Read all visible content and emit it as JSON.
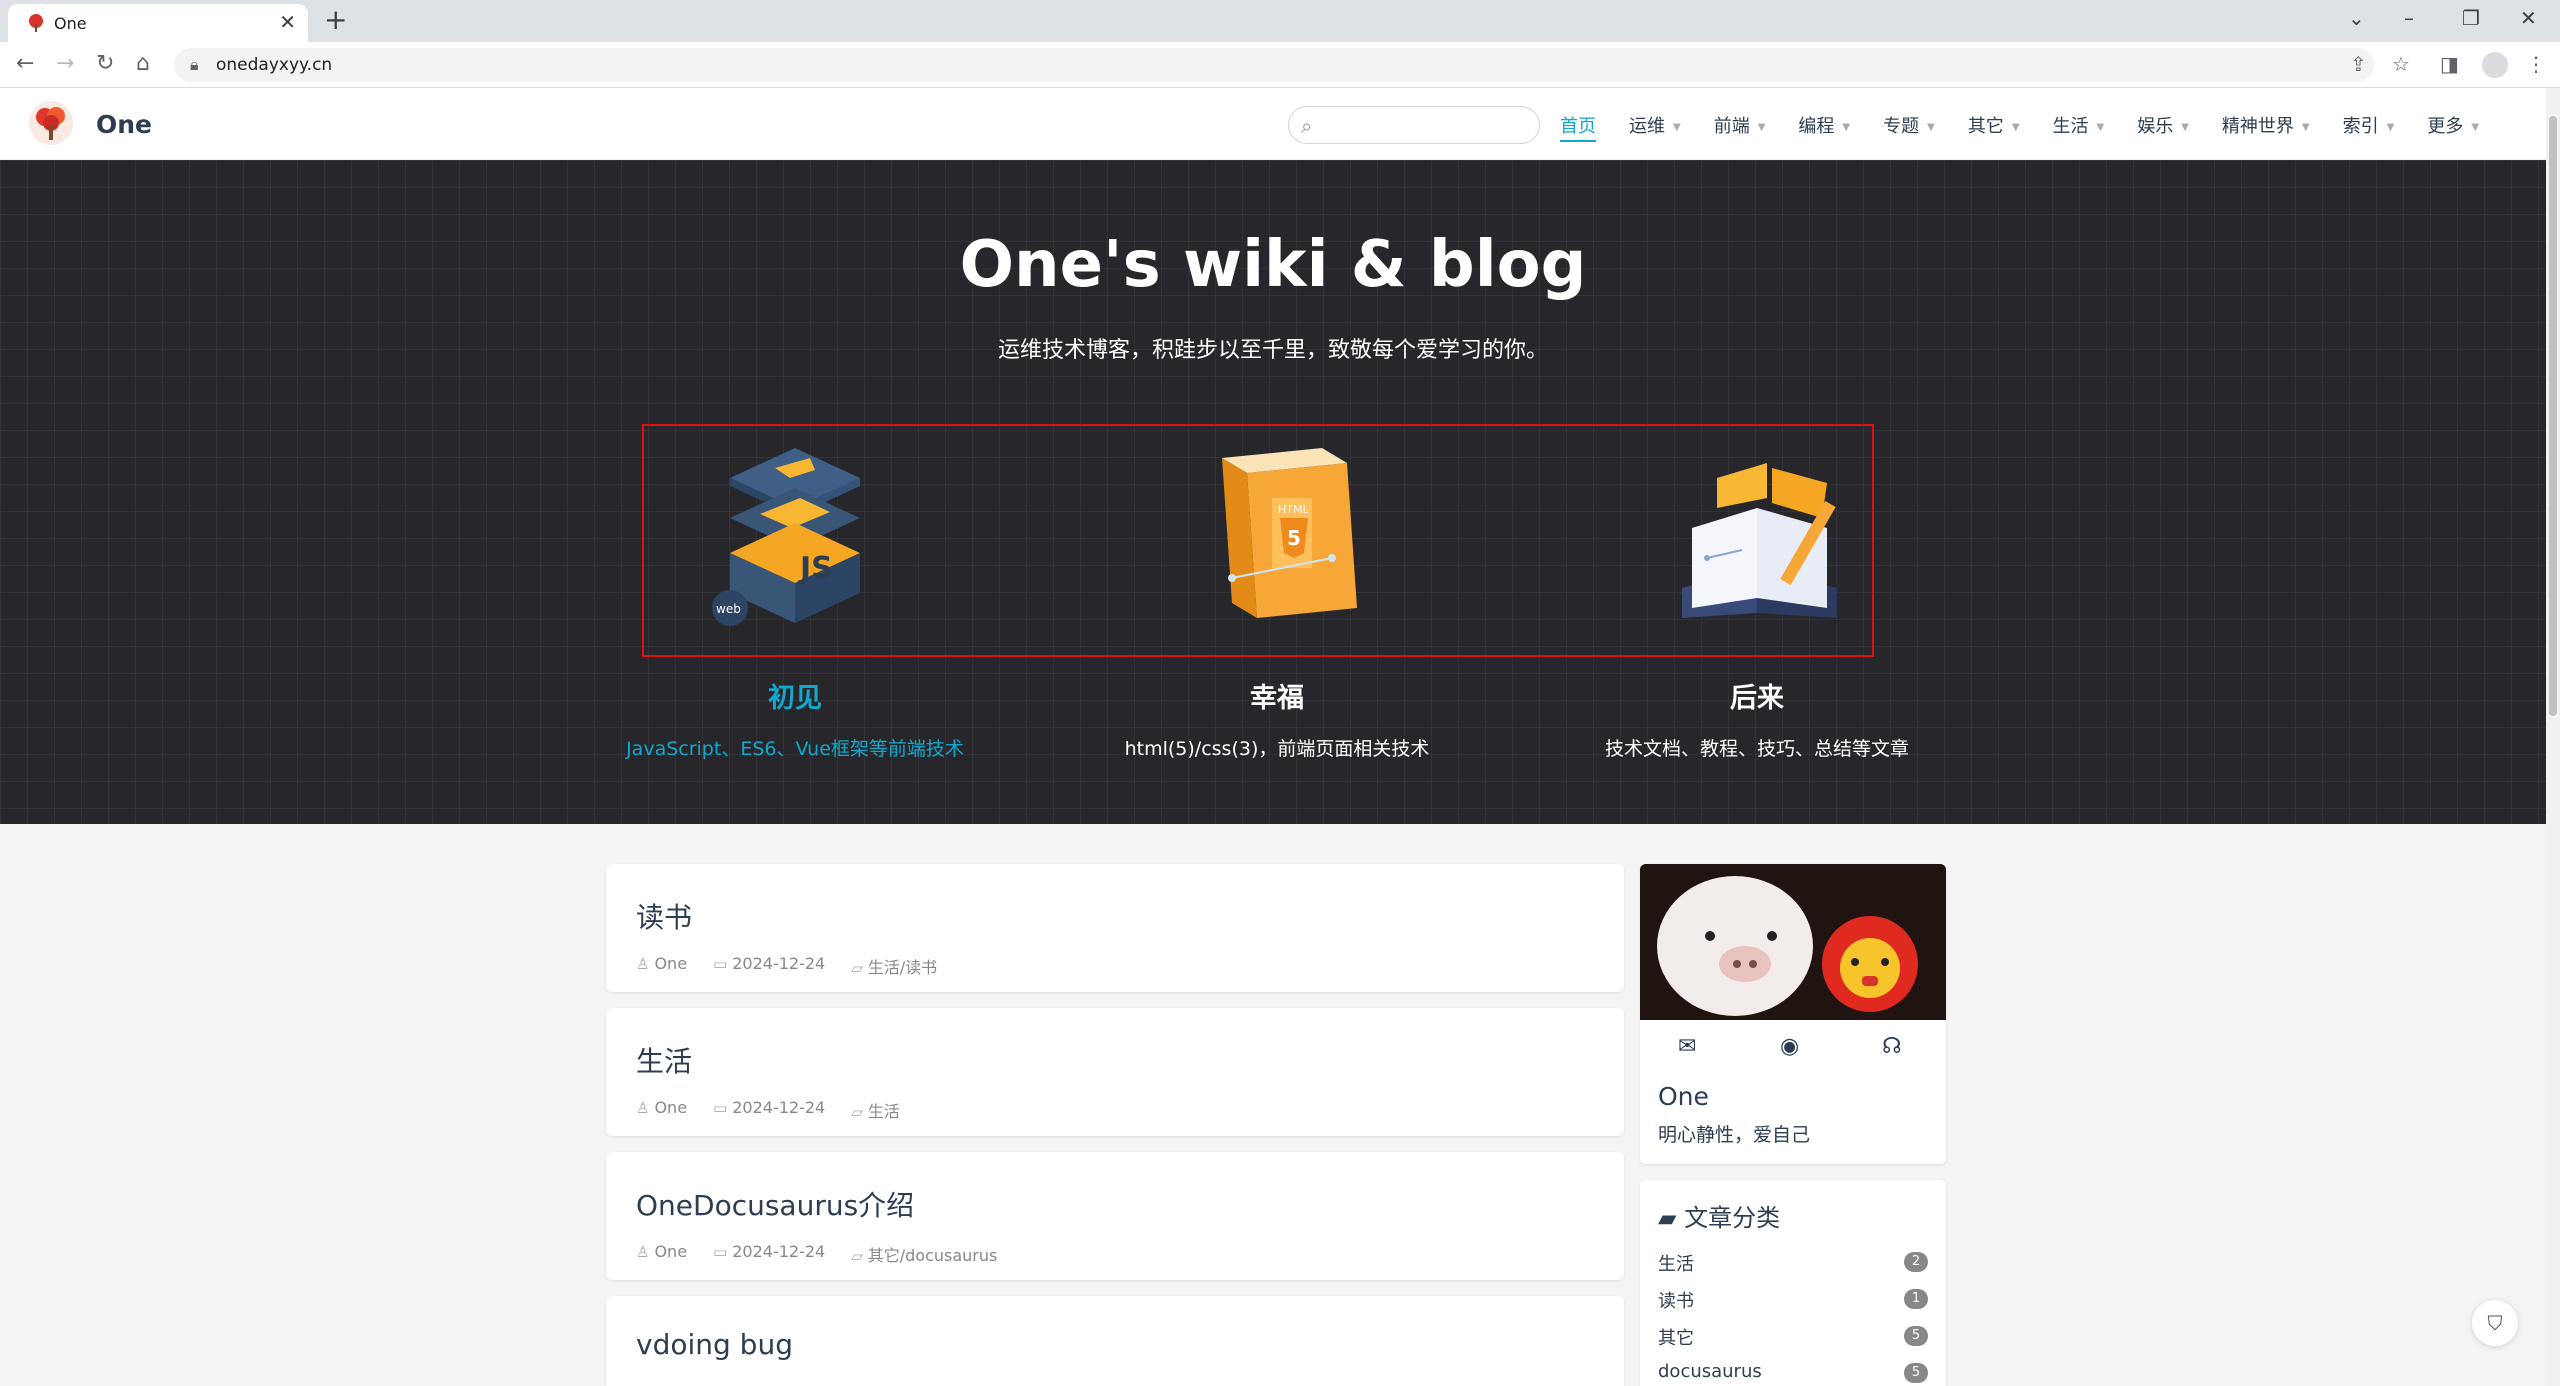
{
  "browser": {
    "tab_title": "One",
    "tab_close": "✕",
    "new_tab": "+",
    "url": "onedayxyy.cn"
  },
  "site": {
    "name": "One",
    "search_placeholder": ""
  },
  "menu": [
    {
      "label": "首页",
      "active": true,
      "dropdown": false
    },
    {
      "label": "运维",
      "dropdown": true
    },
    {
      "label": "前端",
      "dropdown": true
    },
    {
      "label": "编程",
      "dropdown": true
    },
    {
      "label": "专题",
      "dropdown": true
    },
    {
      "label": "其它",
      "dropdown": true
    },
    {
      "label": "生活",
      "dropdown": true
    },
    {
      "label": "娱乐",
      "dropdown": true
    },
    {
      "label": "精神世界",
      "dropdown": true
    },
    {
      "label": "索引",
      "dropdown": true
    },
    {
      "label": "更多",
      "dropdown": true
    }
  ],
  "hero": {
    "title": "One's wiki & blog",
    "description": "运维技术博客，积跬步以至千里，致敬每个爱学习的你。",
    "features": [
      {
        "name": "初见",
        "desc": "JavaScript、ES6、Vue框架等前端技术",
        "icon": "web-js-layers-icon",
        "highlighted": true
      },
      {
        "name": "幸福",
        "desc": "html(5)/css(3)，前端页面相关技术",
        "icon": "html5-page-icon",
        "highlighted": false
      },
      {
        "name": "后来",
        "desc": "技术文档、教程、技巧、总结等文章",
        "icon": "open-book-icon",
        "highlighted": false
      }
    ]
  },
  "posts": [
    {
      "title": "读书",
      "author": "One",
      "date": "2024-12-24",
      "category": "生活/读书"
    },
    {
      "title": "生活",
      "author": "One",
      "date": "2024-12-24",
      "category": "生活"
    },
    {
      "title": "OneDocusaurus介绍",
      "author": "One",
      "date": "2024-12-24",
      "category": "其它/docusaurus"
    },
    {
      "title": "vdoing bug",
      "author": "",
      "date": "",
      "category": ""
    }
  ],
  "blogger": {
    "name": "One",
    "slogan": "明心静性，爱自己",
    "social": [
      "mail-icon",
      "github-icon",
      "headphones-icon"
    ]
  },
  "categories": {
    "title": "文章分类",
    "items": [
      {
        "name": "生活",
        "count": "2"
      },
      {
        "name": "读书",
        "count": "1"
      },
      {
        "name": "其它",
        "count": "5"
      },
      {
        "name": "docusaurus",
        "count": "5"
      }
    ]
  },
  "colors": {
    "accent": "#11a8cd",
    "hero_bg": "#27272b",
    "highlight_border": "#dd1111"
  }
}
